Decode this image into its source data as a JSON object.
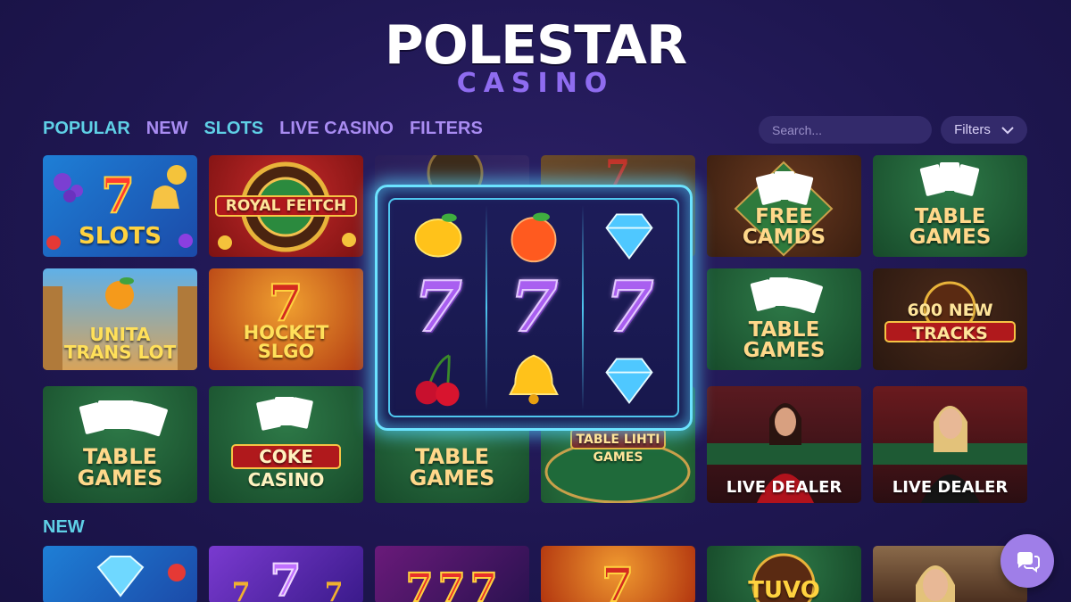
{
  "brand": {
    "name": "POLESTAR",
    "sub": "CASINO"
  },
  "nav": [
    "POPULAR",
    "NEW",
    "SLOTS",
    "LIVE CASINO",
    "FILTERS"
  ],
  "search": {
    "placeholder": "Search..."
  },
  "filters_button": {
    "label": "Filters"
  },
  "tiles": [
    {
      "label": "SLOTS",
      "theme": "slots-blue"
    },
    {
      "label": "ROYAL FEITCH",
      "theme": "roulette-red"
    },
    {
      "label": "",
      "theme": "roulette-dim"
    },
    {
      "label": "",
      "theme": "seven-dim"
    },
    {
      "label": "FREE CAMDS",
      "theme": "cards-brown"
    },
    {
      "label": "TABLE GAMES",
      "theme": "cards-green"
    },
    {
      "label": "UNITA TRANS LOT",
      "theme": "fruit-temple"
    },
    {
      "label": "HOCKET SLGO",
      "theme": "seven-red"
    },
    {
      "label": "TABLE GAMES",
      "theme": "cards-green"
    },
    {
      "label": "600 NEW TRACKS",
      "theme": "cards-dark"
    },
    {
      "label": "TABLE GAMES",
      "theme": "cards-green"
    },
    {
      "label": "COKE CASINO",
      "theme": "cards-green"
    },
    {
      "label": "TABLE GAMES",
      "theme": "cards-green"
    },
    {
      "label": "TABLE LIHTI GAMES",
      "theme": "table-green"
    },
    {
      "label": "LIVE DEALER",
      "theme": "dealer-dark"
    },
    {
      "label": "LIVE DEALER",
      "theme": "dealer-red"
    }
  ],
  "section_new": "NEW",
  "new_tiles": [
    {
      "label": "",
      "theme": "diamond-blue"
    },
    {
      "label": "",
      "theme": "seven-purple"
    },
    {
      "label": "",
      "theme": "seven-red"
    },
    {
      "label": "",
      "theme": "seven-orange"
    },
    {
      "label": "TUVO",
      "theme": "roulette-green"
    },
    {
      "label": "",
      "theme": "dealer-gold"
    }
  ],
  "slot_machine": {
    "reels": [
      [
        "lemon-icon",
        "seven-icon",
        "cherry-icon"
      ],
      [
        "orange-icon",
        "seven-icon",
        "bell-icon"
      ],
      [
        "diamond-icon",
        "seven-icon",
        "diamond-icon"
      ]
    ],
    "seven": "7"
  },
  "colors": {
    "accent_cyan": "#5fd0e6",
    "accent_purple": "#a98cf2",
    "background": "#1f1752",
    "gold": "#f6c344"
  }
}
